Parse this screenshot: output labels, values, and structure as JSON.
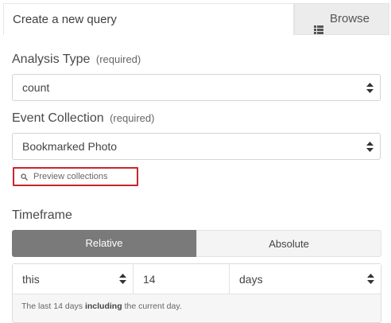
{
  "tabs": {
    "active_label": "Create a new query",
    "browse_label": "Browse",
    "browse_icon": "list-icon"
  },
  "analysis_type": {
    "label": "Analysis Type",
    "required": "(required)",
    "value": "count"
  },
  "event_collection": {
    "label": "Event Collection",
    "required": "(required)",
    "value": "Bookmarked Photo",
    "preview_label": "Preview collections",
    "preview_icon": "search-icon",
    "preview_border_color": "#c9252c"
  },
  "timeframe": {
    "label": "Timeframe",
    "toggle": {
      "relative_label": "Relative",
      "absolute_label": "Absolute",
      "selected": "Relative"
    },
    "relative_value": "this",
    "amount_value": "14",
    "unit_value": "days",
    "note_prefix": "The last 14 days",
    "note_bold": "including",
    "note_suffix": "the current day."
  }
}
